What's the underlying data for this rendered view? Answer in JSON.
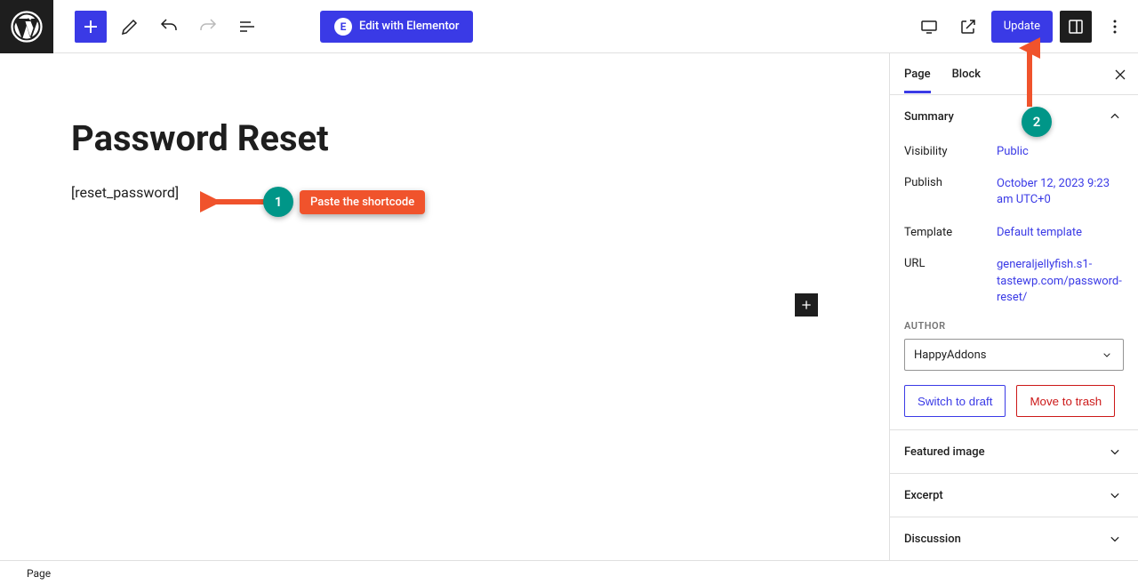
{
  "toolbar": {
    "elementor_label": "Edit with Elementor",
    "update_label": "Update"
  },
  "editor": {
    "page_title": "Password Reset",
    "shortcode_text": "[reset_password]"
  },
  "sidebar": {
    "tabs": {
      "page": "Page",
      "block": "Block"
    },
    "summary": {
      "title": "Summary",
      "visibility_label": "Visibility",
      "visibility_value": "Public",
      "publish_label": "Publish",
      "publish_value": "October 12, 2023 9:23 am UTC+0",
      "template_label": "Template",
      "template_value": "Default template",
      "url_label": "URL",
      "url_value": "generaljellyfish.s1-tastewp.com/password-reset/",
      "author_title": "Author",
      "author_value": "HappyAddons",
      "switch_draft": "Switch to draft",
      "move_trash": "Move to trash"
    },
    "featured_image": "Featured image",
    "excerpt": "Excerpt",
    "discussion": "Discussion"
  },
  "footer": {
    "breadcrumb": "Page"
  },
  "annotations": {
    "step1_num": "1",
    "step1_text": "Paste the shortcode",
    "step2_num": "2"
  }
}
